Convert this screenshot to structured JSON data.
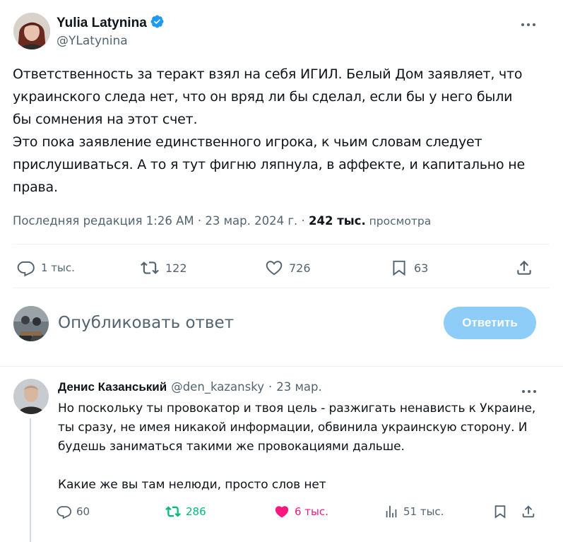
{
  "tweet": {
    "author_name": "Yulia Latynina",
    "handle": "@YLatynina",
    "text_lines": [
      "Ответственность за теракт взял на себя ИГИЛ. Белый Дом заявляет, что",
      "украинского следа нет, что он вряд ли бы сделал, если бы у него были",
      "бы сомнения на этот счет.",
      "Это пока заявление единственного игрока, к чьим словам следует",
      "прислушиваться. А то я тут фигню  ляпнула, в аффекте, и капитально не",
      "права."
    ],
    "meta": {
      "edited_label": "Последняя редакция 1:26 AM · 23 мар. 2024 г. · ",
      "views_count": "242 тыс.",
      "views_label": " просмотра"
    },
    "stats": {
      "replies": "1 тыс.",
      "retweets": "122",
      "likes": "726",
      "bookmarks": "63"
    }
  },
  "composer": {
    "placeholder": "Опубликовать ответ",
    "button_label": "Ответить"
  },
  "reply": {
    "author_name": "Денис Казанський",
    "handle": "@den_kazansky",
    "date": "23 мар.",
    "separator": "·",
    "text_lines": [
      "Но поскольку ты провокатор и твоя цель - разжигать ненависть к Украине,",
      "ты сразу, не имея никакой информации, обвинила украинскую сторону. И",
      "будешь заниматься такими же провокациями дальше.",
      "",
      "Какие же вы там нелюди, просто слов нет"
    ],
    "stats": {
      "replies": "60",
      "retweets": "286",
      "likes": "6 тыс.",
      "views": "51 тыс."
    }
  },
  "colors": {
    "verified": "#1d9bf0",
    "reply_button": "#8ecdf8",
    "retweet_active": "#00ba7c",
    "like_active": "#f91880",
    "thread_line": "#cfd9de"
  },
  "icons": [
    "more-icon",
    "verified-badge-icon",
    "reply-icon",
    "retweet-icon",
    "like-icon",
    "bookmark-icon",
    "share-icon",
    "views-icon"
  ]
}
